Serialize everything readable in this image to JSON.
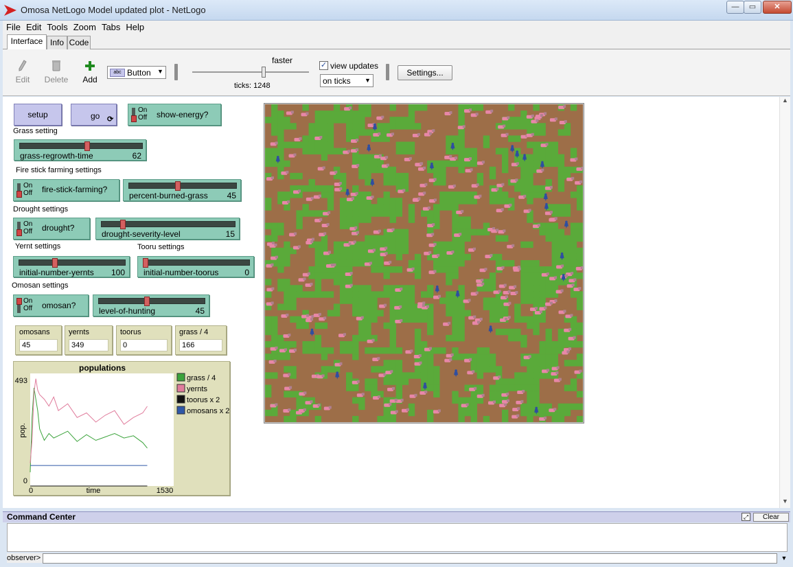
{
  "window": {
    "title": "Omosa NetLogo Model updated plot - NetLogo",
    "controls": [
      "—",
      "▭",
      "✕"
    ]
  },
  "menu": [
    "File",
    "Edit",
    "Tools",
    "Zoom",
    "Tabs",
    "Help"
  ],
  "tabs": [
    "Interface",
    "Info",
    "Code"
  ],
  "toolbar": {
    "edit": "Edit",
    "delete": "Delete",
    "add": "Add",
    "widget_type": "Button",
    "speed_label": "faster",
    "ticks": "ticks: 1248",
    "view_updates": "view updates",
    "update_mode": "on ticks",
    "settings": "Settings..."
  },
  "buttons": {
    "setup": "setup",
    "go": "go"
  },
  "switches": {
    "on": "On",
    "off": "Off",
    "show_energy": "show-energy?",
    "fire_stick": "fire-stick-farming?",
    "drought": "drought?",
    "omosan": "omosan?"
  },
  "notes": {
    "grass": "Grass setting",
    "fire": "Fire stick farming settings",
    "drought": "Drought settings",
    "yernt": "Yernt settings",
    "tooru": "Tooru settings",
    "omosan": "Omosan settings"
  },
  "sliders": {
    "grass_regrowth": {
      "label": "grass-regrowth-time",
      "value": "62",
      "fraction": 0.55
    },
    "percent_burned": {
      "label": "percent-burned-grass",
      "value": "45",
      "fraction": 0.45
    },
    "drought_severity": {
      "label": "drought-severity-level",
      "value": "15",
      "fraction": 0.15
    },
    "yernts": {
      "label": "initial-number-yernts",
      "value": "100",
      "fraction": 0.33
    },
    "toorus": {
      "label": "initial-number-toorus",
      "value": "0",
      "fraction": 0.0
    },
    "hunting": {
      "label": "level-of-hunting",
      "value": "45",
      "fraction": 0.45
    }
  },
  "monitors": [
    {
      "label": "omosans",
      "value": "45"
    },
    {
      "label": "yernts",
      "value": "349"
    },
    {
      "label": "toorus",
      "value": "0"
    },
    {
      "label": "grass / 4",
      "value": "166"
    }
  ],
  "chart_data": {
    "type": "line",
    "title": "populations",
    "xlabel": "time",
    "ylabel": "pop.",
    "xlim": [
      0,
      1530
    ],
    "ylim": [
      0,
      493
    ],
    "x_tick_labels": [
      "0",
      "1530"
    ],
    "y_tick_labels": [
      "0",
      "493"
    ],
    "legend_position": "right",
    "series": [
      {
        "name": "grass / 4",
        "color": "#3ba33b",
        "x": [
          0,
          20,
          40,
          60,
          80,
          100,
          150,
          200,
          250,
          300,
          400,
          500,
          600,
          700,
          800,
          900,
          1000,
          1100,
          1200,
          1248
        ],
        "values": [
          60,
          300,
          430,
          380,
          330,
          250,
          200,
          230,
          210,
          220,
          240,
          195,
          225,
          200,
          215,
          230,
          210,
          220,
          190,
          166
        ]
      },
      {
        "name": "yernts",
        "color": "#e07c9c",
        "x": [
          0,
          20,
          40,
          60,
          80,
          100,
          150,
          200,
          250,
          300,
          400,
          500,
          600,
          700,
          800,
          900,
          1000,
          1100,
          1200,
          1248
        ],
        "values": [
          100,
          200,
          410,
          470,
          420,
          400,
          380,
          350,
          390,
          330,
          360,
          300,
          320,
          280,
          310,
          330,
          270,
          300,
          320,
          349
        ]
      },
      {
        "name": "toorus x 2",
        "color": "#111111",
        "x": [
          0,
          1248
        ],
        "values": [
          0,
          0
        ]
      },
      {
        "name": "omosans x 2",
        "color": "#2f58a8",
        "x": [
          0,
          20,
          1248
        ],
        "values": [
          90,
          90,
          90
        ]
      }
    ]
  },
  "command_center": {
    "title": "Command Center",
    "clear": "Clear",
    "prompt": "observer>"
  },
  "colors": {
    "grass": "#5aaa3a",
    "dirt": "#9d6e48",
    "yernt": "#e887a8",
    "omosan": "#2f4ea0",
    "button": "#c6c6ec",
    "widget": "#8dcbb7",
    "monitor": "#e0e0bc"
  }
}
